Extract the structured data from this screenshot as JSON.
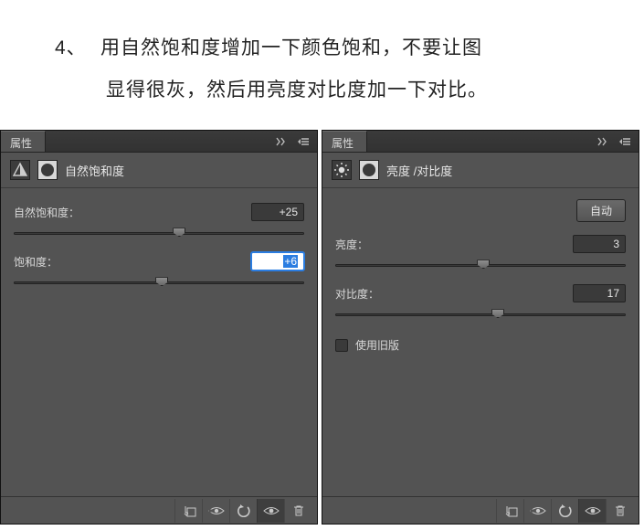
{
  "instruction": {
    "number": "4、",
    "line1": "用自然饱和度增加一下颜色饱和，不要让图",
    "line2": "显得很灰，然后用亮度对比度加一下对比。"
  },
  "left_panel": {
    "tab": "属性",
    "title": "自然饱和度",
    "vibrance": {
      "label": "自然饱和度：",
      "value": "+25",
      "thumb_pct": 57
    },
    "saturation": {
      "label": "饱和度：",
      "value": "+6",
      "thumb_pct": 51,
      "editing": true
    },
    "footer_icons": [
      "clip-to-layer-icon",
      "view-previous-icon",
      "reset-icon",
      "visibility-icon",
      "trash-icon"
    ]
  },
  "right_panel": {
    "tab": "属性",
    "title": "亮度 /对比度",
    "auto_button": "自动",
    "brightness": {
      "label": "亮度：",
      "value": "3",
      "thumb_pct": 51
    },
    "contrast": {
      "label": "对比度：",
      "value": "17",
      "thumb_pct": 56
    },
    "legacy": {
      "label": "使用旧版",
      "checked": false
    },
    "footer_icons": [
      "clip-to-layer-icon",
      "view-previous-icon",
      "reset-icon",
      "visibility-icon",
      "trash-icon"
    ]
  }
}
